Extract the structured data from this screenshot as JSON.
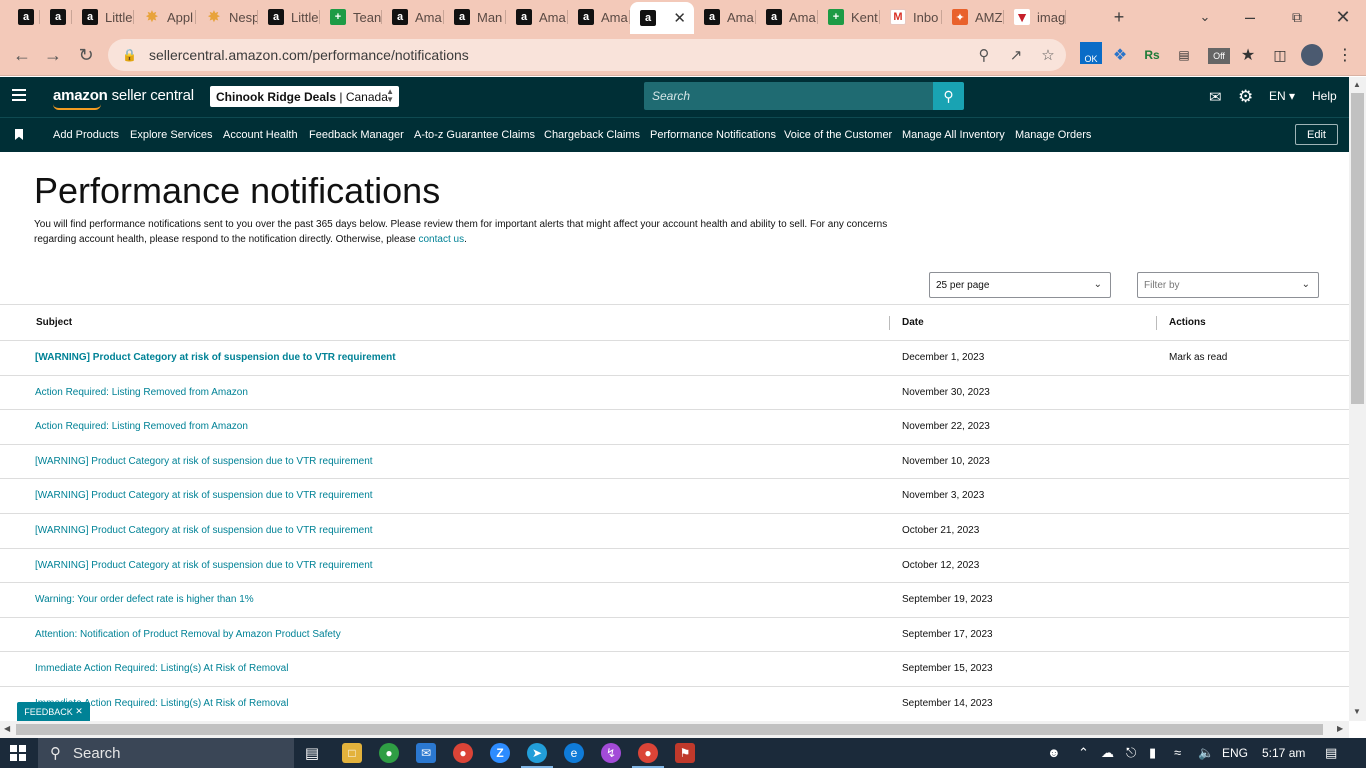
{
  "browser": {
    "tabs": [
      {
        "label": "",
        "icon": "amazon-icon"
      },
      {
        "label": "",
        "icon": "amazon-icon"
      },
      {
        "label": "Little",
        "icon": "amazon-icon"
      },
      {
        "label": "Appl",
        "icon": "star-icon"
      },
      {
        "label": "Nesp",
        "icon": "star-icon"
      },
      {
        "label": "Little",
        "icon": "amazon-icon"
      },
      {
        "label": "Tean",
        "icon": "green-plus-icon"
      },
      {
        "label": "Ama",
        "icon": "amazon-icon"
      },
      {
        "label": "Man",
        "icon": "amazon-icon"
      },
      {
        "label": "Ama",
        "icon": "amazon-icon"
      },
      {
        "label": "Ama",
        "icon": "amazon-icon"
      },
      {
        "label": "",
        "icon": "amazon-icon",
        "active": true
      },
      {
        "label": "Ama",
        "icon": "amazon-icon"
      },
      {
        "label": "Ama",
        "icon": "amazon-icon"
      },
      {
        "label": "Kent",
        "icon": "green-plus-icon"
      },
      {
        "label": "Inbo",
        "icon": "gmail-icon"
      },
      {
        "label": "AMZ",
        "icon": "orange-icon"
      },
      {
        "label": "imag",
        "icon": "red-v-icon"
      }
    ],
    "url": "sellercentral.amazon.com/performance/notifications",
    "extension_badges": {
      "ok": "OK",
      "off": "Off",
      "rs": "Rs"
    }
  },
  "header": {
    "logo_bold": "amazon",
    "logo_rest": " seller central",
    "account_store": "Chinook Ridge Deals",
    "account_market": "Canada",
    "search_placeholder": "Search",
    "language": "EN",
    "help": "Help"
  },
  "shortcuts": {
    "items": [
      "Add Products",
      "Explore Services",
      "Account Health",
      "Feedback Manager",
      "A-to-z Guarantee Claims",
      "Chargeback Claims",
      "Performance Notifications",
      "Voice of the Customer",
      "Manage All Inventory",
      "Manage Orders"
    ],
    "edit": "Edit"
  },
  "page": {
    "title": "Performance notifications",
    "intro": "You will find performance notifications sent to you over the past 365 days below. Please review them for important alerts that might affect your account health and ability to sell. For any concerns regarding account health, please respond to the notification directly. Otherwise, please ",
    "contact_link": "contact us",
    "intro_end": ".",
    "per_page": "25 per page",
    "filter_placeholder": "Filter by"
  },
  "table": {
    "headers": {
      "subject": "Subject",
      "date": "Date",
      "actions": "Actions"
    },
    "rows": [
      {
        "subject": "[WARNING] Product Category at risk of suspension due to VTR requirement",
        "date": "December 1, 2023",
        "action": "Mark as read",
        "unread": true
      },
      {
        "subject": "Action Required: Listing Removed from Amazon",
        "date": "November 30, 2023",
        "action": ""
      },
      {
        "subject": "Action Required: Listing Removed from Amazon",
        "date": "November 22, 2023",
        "action": ""
      },
      {
        "subject": "[WARNING] Product Category at risk of suspension due to VTR requirement",
        "date": "November 10, 2023",
        "action": ""
      },
      {
        "subject": "[WARNING] Product Category at risk of suspension due to VTR requirement",
        "date": "November 3, 2023",
        "action": ""
      },
      {
        "subject": "[WARNING] Product Category at risk of suspension due to VTR requirement",
        "date": "October 21, 2023",
        "action": ""
      },
      {
        "subject": "[WARNING] Product Category at risk of suspension due to VTR requirement",
        "date": "October 12, 2023",
        "action": ""
      },
      {
        "subject": "Warning: Your order defect rate is higher than 1%",
        "date": "September 19, 2023",
        "action": ""
      },
      {
        "subject": "Attention: Notification of Product Removal by Amazon Product Safety",
        "date": "September 17, 2023",
        "action": ""
      },
      {
        "subject": "Immediate Action Required: Listing(s) At Risk of Removal",
        "date": "September 15, 2023",
        "action": ""
      },
      {
        "subject": "Immediate Action Required: Listing(s) At Risk of Removal",
        "date": "September 14, 2023",
        "action": ""
      }
    ]
  },
  "feedback": "FEEDBACK",
  "taskbar": {
    "search": "Search",
    "language": "ENG",
    "time": "5:17 am"
  },
  "colors": {
    "header_bg": "#002f36",
    "link": "#008296",
    "search_btn": "#19a3b3",
    "tabstrip": "#f3c9b9"
  }
}
